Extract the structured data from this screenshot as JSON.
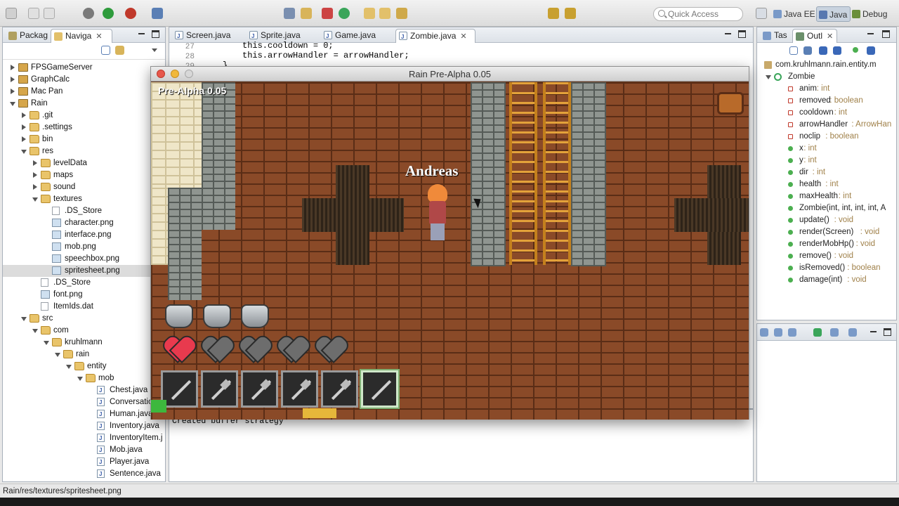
{
  "toolbar": {
    "quick_access_placeholder": "Quick Access",
    "perspectives": [
      "Java EE",
      "Java",
      "Debug"
    ]
  },
  "left_panel": {
    "tabs": [
      "Packag",
      "Naviga"
    ],
    "tree": [
      {
        "label": "FPSGameServer",
        "indent": 0,
        "twist": "closed",
        "icon": "proj"
      },
      {
        "label": "GraphCalc",
        "indent": 0,
        "twist": "closed",
        "icon": "proj"
      },
      {
        "label": "Mac Pan",
        "indent": 0,
        "twist": "closed",
        "icon": "proj"
      },
      {
        "label": "Rain",
        "indent": 0,
        "twist": "open",
        "icon": "proj"
      },
      {
        "label": ".git",
        "indent": 1,
        "twist": "closed",
        "icon": "fold"
      },
      {
        "label": ".settings",
        "indent": 1,
        "twist": "closed",
        "icon": "fold"
      },
      {
        "label": "bin",
        "indent": 1,
        "twist": "closed",
        "icon": "fold"
      },
      {
        "label": "res",
        "indent": 1,
        "twist": "open",
        "icon": "fold"
      },
      {
        "label": "levelData",
        "indent": 2,
        "twist": "closed",
        "icon": "fold"
      },
      {
        "label": "maps",
        "indent": 2,
        "twist": "closed",
        "icon": "fold"
      },
      {
        "label": "sound",
        "indent": 2,
        "twist": "closed",
        "icon": "fold"
      },
      {
        "label": "textures",
        "indent": 2,
        "twist": "open",
        "icon": "fold"
      },
      {
        "label": ".DS_Store",
        "indent": 3,
        "twist": "none",
        "icon": "file"
      },
      {
        "label": "character.png",
        "indent": 3,
        "twist": "none",
        "icon": "img"
      },
      {
        "label": "interface.png",
        "indent": 3,
        "twist": "none",
        "icon": "img"
      },
      {
        "label": "mob.png",
        "indent": 3,
        "twist": "none",
        "icon": "img"
      },
      {
        "label": "speechbox.png",
        "indent": 3,
        "twist": "none",
        "icon": "img"
      },
      {
        "label": "spritesheet.png",
        "indent": 3,
        "twist": "none",
        "icon": "img",
        "selected": true
      },
      {
        "label": ".DS_Store",
        "indent": 2,
        "twist": "none",
        "icon": "file"
      },
      {
        "label": "font.png",
        "indent": 2,
        "twist": "none",
        "icon": "img"
      },
      {
        "label": "ItemIds.dat",
        "indent": 2,
        "twist": "none",
        "icon": "file"
      },
      {
        "label": "src",
        "indent": 1,
        "twist": "open",
        "icon": "fold"
      },
      {
        "label": "com",
        "indent": 2,
        "twist": "open",
        "icon": "fold"
      },
      {
        "label": "kruhlmann",
        "indent": 3,
        "twist": "open",
        "icon": "fold"
      },
      {
        "label": "rain",
        "indent": 4,
        "twist": "open",
        "icon": "fold"
      },
      {
        "label": "entity",
        "indent": 5,
        "twist": "open",
        "icon": "fold"
      },
      {
        "label": "mob",
        "indent": 6,
        "twist": "open",
        "icon": "fold"
      },
      {
        "label": "Chest.java",
        "indent": 7,
        "twist": "none",
        "icon": "java"
      },
      {
        "label": "Conversatio",
        "indent": 7,
        "twist": "none",
        "icon": "java"
      },
      {
        "label": "Human.java",
        "indent": 7,
        "twist": "none",
        "icon": "java"
      },
      {
        "label": "Inventory.java",
        "indent": 7,
        "twist": "none",
        "icon": "java"
      },
      {
        "label": "InventoryItem.j",
        "indent": 7,
        "twist": "none",
        "icon": "java"
      },
      {
        "label": "Mob.java",
        "indent": 7,
        "twist": "none",
        "icon": "java"
      },
      {
        "label": "Player.java",
        "indent": 7,
        "twist": "none",
        "icon": "java"
      },
      {
        "label": "Sentence.java",
        "indent": 7,
        "twist": "none",
        "icon": "java"
      }
    ]
  },
  "editor": {
    "tabs": [
      "Screen.java",
      "Sprite.java",
      "Game.java",
      "Zombie.java"
    ],
    "active_tab": "Zombie.java",
    "lines": [
      {
        "num": "27",
        "code": "this.cooldown = 0;"
      },
      {
        "num": "28",
        "code": "this.arrowHandler = arrowHandler;"
      },
      {
        "num": "29",
        "code": "}"
      }
    ]
  },
  "outline": {
    "tabs": [
      "Tas",
      "Outl"
    ],
    "package": "com.kruhlmann.rain.entity.m",
    "class": "Zombie",
    "members": [
      {
        "name": "anim",
        "type": " : int",
        "kind": "field"
      },
      {
        "name": "removed",
        "type": " : boolean",
        "kind": "field"
      },
      {
        "name": "cooldown",
        "type": " : int",
        "kind": "field"
      },
      {
        "name": "arrowHandler",
        "type": " : ArrowHan",
        "kind": "field"
      },
      {
        "name": "noclip",
        "type": " : boolean",
        "kind": "field"
      },
      {
        "name": "x",
        "type": " : int",
        "kind": "method"
      },
      {
        "name": "y",
        "type": " : int",
        "kind": "method"
      },
      {
        "name": "dir",
        "type": " : int",
        "kind": "method"
      },
      {
        "name": "health",
        "type": " : int",
        "kind": "method"
      },
      {
        "name": "maxHealth",
        "type": " : int",
        "kind": "method"
      },
      {
        "name": "Zombie(int, int, int, int, A",
        "type": "",
        "kind": "method"
      },
      {
        "name": "update()",
        "type": " : void",
        "kind": "method"
      },
      {
        "name": "render(Screen)",
        "type": " : void",
        "kind": "method"
      },
      {
        "name": "renderMobHp()",
        "type": " : void",
        "kind": "method"
      },
      {
        "name": "remove()",
        "type": " : void",
        "kind": "method"
      },
      {
        "name": "isRemoved()",
        "type": " : boolean",
        "kind": "method"
      },
      {
        "name": "damage(int)",
        "type": " : void",
        "kind": "method"
      }
    ]
  },
  "game": {
    "window_title": "Rain Pre-Alpha 0.05",
    "version_label": "Pre-Alpha 0.05",
    "player_name": "Andreas",
    "armor_count": 3,
    "health_full": 1,
    "health_total": 5,
    "hotbar": [
      "sword",
      "hammer",
      "axe",
      "spear",
      "wand",
      "bow"
    ],
    "selected_slot": 5
  },
  "console": {
    "text": "Created buffer strategy"
  },
  "status": {
    "path": "Rain/res/textures/spritesheet.png"
  },
  "colors": {
    "accent": "#3b5ea8",
    "heart": "#e83a4e",
    "ladder": "#e3a23a"
  }
}
